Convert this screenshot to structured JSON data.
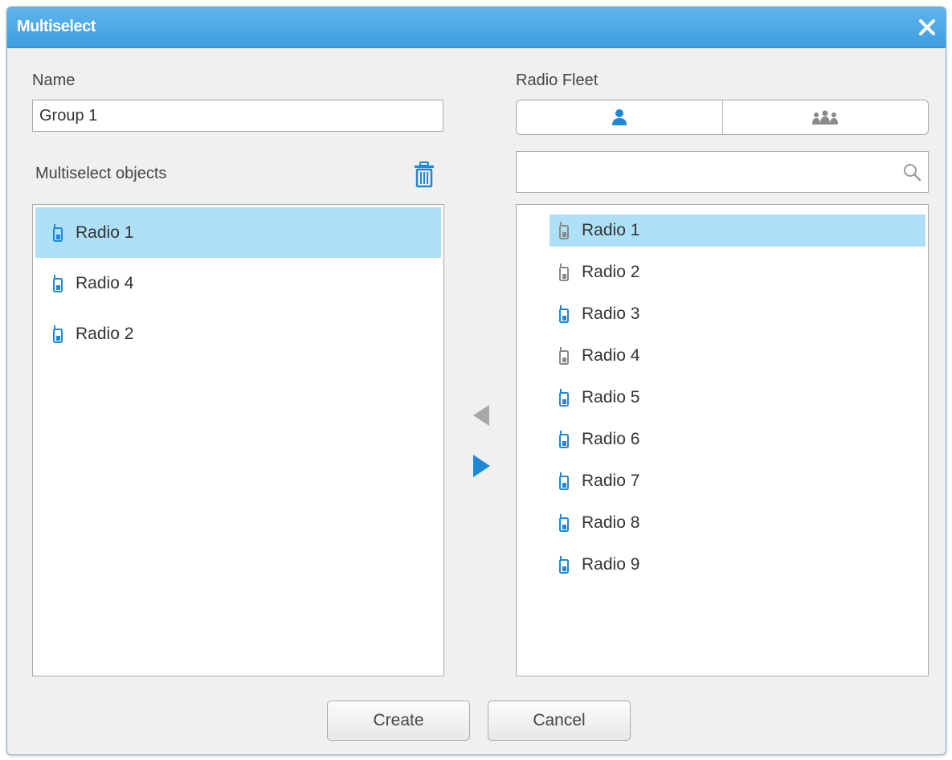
{
  "window": {
    "title": "Multiselect",
    "accent": "#3d9ee0"
  },
  "form": {
    "name_label": "Name",
    "name_value": "Group 1",
    "objects_label": "Multiselect objects",
    "fleet_label": "Radio Fleet",
    "search_placeholder": ""
  },
  "fleet_tabs": [
    {
      "icon": "person-icon",
      "selected": true
    },
    {
      "icon": "group-icon",
      "selected": false
    }
  ],
  "multiselect_objects": [
    {
      "label": "Radio 1",
      "selected": true,
      "icon": "radio-icon",
      "status_color": "#1e88d8"
    },
    {
      "label": "Radio 4",
      "selected": false,
      "icon": "radio-icon",
      "status_color": "#1e88d8"
    },
    {
      "label": "Radio 2",
      "selected": false,
      "icon": "radio-icon",
      "status_color": "#1e88d8"
    }
  ],
  "radio_fleet": [
    {
      "label": "Radio 1",
      "selected": true,
      "status_color": "#8a8a8a"
    },
    {
      "label": "Radio 2",
      "selected": false,
      "status_color": "#8a8a8a"
    },
    {
      "label": "Radio 3",
      "selected": false,
      "status_color": "#1e88d8"
    },
    {
      "label": "Radio 4",
      "selected": false,
      "status_color": "#8a8a8a"
    },
    {
      "label": "Radio 5",
      "selected": false,
      "status_color": "#1e88d8"
    },
    {
      "label": "Radio 6",
      "selected": false,
      "status_color": "#1e88d8"
    },
    {
      "label": "Radio 7",
      "selected": false,
      "status_color": "#1e88d8"
    },
    {
      "label": "Radio 8",
      "selected": false,
      "status_color": "#1e88d8"
    },
    {
      "label": "Radio 9",
      "selected": false,
      "status_color": "#1e88d8"
    }
  ],
  "transfer": {
    "remove_arrow_color": "#a8a8a8",
    "add_arrow_color": "#1e88d8"
  },
  "buttons": {
    "create": "Create",
    "cancel": "Cancel"
  }
}
